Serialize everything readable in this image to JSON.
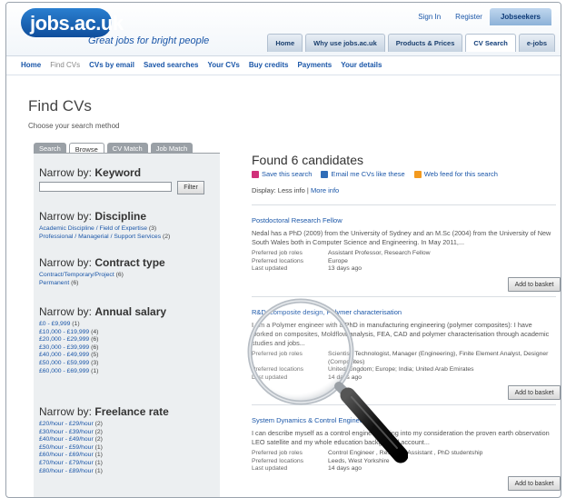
{
  "brand": {
    "name": "jobs.ac.uk",
    "tagline": "Great jobs for bright people"
  },
  "top_links": [
    "Sign In",
    "Register",
    "Jobseekers"
  ],
  "tabs": [
    "Home",
    "Why use jobs.ac.uk",
    "Products & Prices",
    "CV Search",
    "e-jobs"
  ],
  "subnav": [
    "Home",
    "Find CVs",
    "CVs by email",
    "Saved searches",
    "Your CVs",
    "Buy credits",
    "Payments",
    "Your details"
  ],
  "page": {
    "title": "Find CVs",
    "subtitle": "Choose your search method"
  },
  "search_tabs": [
    "Search",
    "Browse",
    "CV Match",
    "Job Match"
  ],
  "keyword": {
    "heading_prefix": "Narrow by:",
    "heading": "Keyword",
    "filter_label": "Filter",
    "value": ""
  },
  "discipline": {
    "heading_prefix": "Narrow by:",
    "heading": "Discipline",
    "items": [
      {
        "label": "Academic Discipline / Field of Expertise",
        "count": "(3)"
      },
      {
        "label": "Professional / Managerial / Support Services",
        "count": "(2)"
      }
    ]
  },
  "contract": {
    "heading_prefix": "Narrow by:",
    "heading": "Contract type",
    "items": [
      {
        "label": "Contract/Temporary/Project",
        "count": "(6)"
      },
      {
        "label": "Permanent",
        "count": "(6)"
      }
    ]
  },
  "salary": {
    "heading_prefix": "Narrow by:",
    "heading": "Annual salary",
    "items": [
      {
        "label": "£0 - £9,999",
        "count": "(1)"
      },
      {
        "label": "£10,000 - £19,999",
        "count": "(4)"
      },
      {
        "label": "£20,000 - £29,999",
        "count": "(6)"
      },
      {
        "label": "£30,000 - £39,999",
        "count": "(6)"
      },
      {
        "label": "£40,000 - £49,999",
        "count": "(5)"
      },
      {
        "label": "£50,000 - £59,999",
        "count": "(3)"
      },
      {
        "label": "£60,000 - £69,999",
        "count": "(1)"
      }
    ]
  },
  "freelance": {
    "heading_prefix": "Narrow by:",
    "heading": "Freelance rate",
    "items": [
      {
        "label": "£20/hour - £29/hour",
        "count": "(2)"
      },
      {
        "label": "£30/hour - £39/hour",
        "count": "(2)"
      },
      {
        "label": "£40/hour - £49/hour",
        "count": "(2)"
      },
      {
        "label": "£50/hour - £59/hour",
        "count": "(1)"
      },
      {
        "label": "£60/hour - £69/hour",
        "count": "(1)"
      },
      {
        "label": "£70/hour - £79/hour",
        "count": "(1)"
      },
      {
        "label": "£80/hour - £89/hour",
        "count": "(1)"
      }
    ]
  },
  "results": {
    "found": "Found 6 candidates",
    "save_search": "Save this search",
    "email_cvs": "Email me CVs like these",
    "web_feed": "Web feed for this search",
    "display_label": "Display:",
    "display_less": "Less info",
    "display_sep": "|",
    "display_more": "More info",
    "basket_label": "Add to basket",
    "meta_labels": {
      "roles": "Preferred job roles",
      "locations": "Preferred locations",
      "updated": "Last updated"
    },
    "cards": [
      {
        "title": "Postdoctoral Research Fellow",
        "desc": "Nedal has a PhD (2009) from the University of Sydney and an M.Sc (2004) from the University of New South Wales both in Computer Science and Engineering. In May 2011,...",
        "roles": "Assistant Professor, Research Fellow",
        "locations": "Europe",
        "updated": "13 days ago"
      },
      {
        "title": "R&D, composite design, Polymer characterisation",
        "desc": "I am a Polymer engineer with a PhD in manufacturing engineering (polymer composites): I have worked on composites, Moldflow analysis, FEA, CAD and polymer characterisation through academic studies and jobs...",
        "roles": "Scientist, Technologist, Manager (Engineering), Finite Element Analyst, Designer (Composites)",
        "locations": "United Kingdom; Europe; India; United Arab Emirates",
        "updated": "14 days ago"
      },
      {
        "title": "System Dynamics & Control Engineer",
        "desc": "I can describe myself as a control engineer, taking into my consideration the proven earth observation LEO satellite and my whole education background account...",
        "roles": "Control Engineer , Research Assistant , PhD studentship",
        "locations": "Leeds, West Yorkshire",
        "updated": "14 days ago"
      }
    ]
  },
  "colors": {
    "brand_blue": "#1a56a8",
    "logo_blue": "#0f4e9c",
    "panel_grey": "#eceff1",
    "tab_grey": "#9aa0a6",
    "rss_orange": "#f39a1e",
    "save_pink": "#d0307a"
  },
  "icons": [
    "save-search-icon",
    "email-icon",
    "rss-feed-icon",
    "magnifying-glass-icon"
  ]
}
